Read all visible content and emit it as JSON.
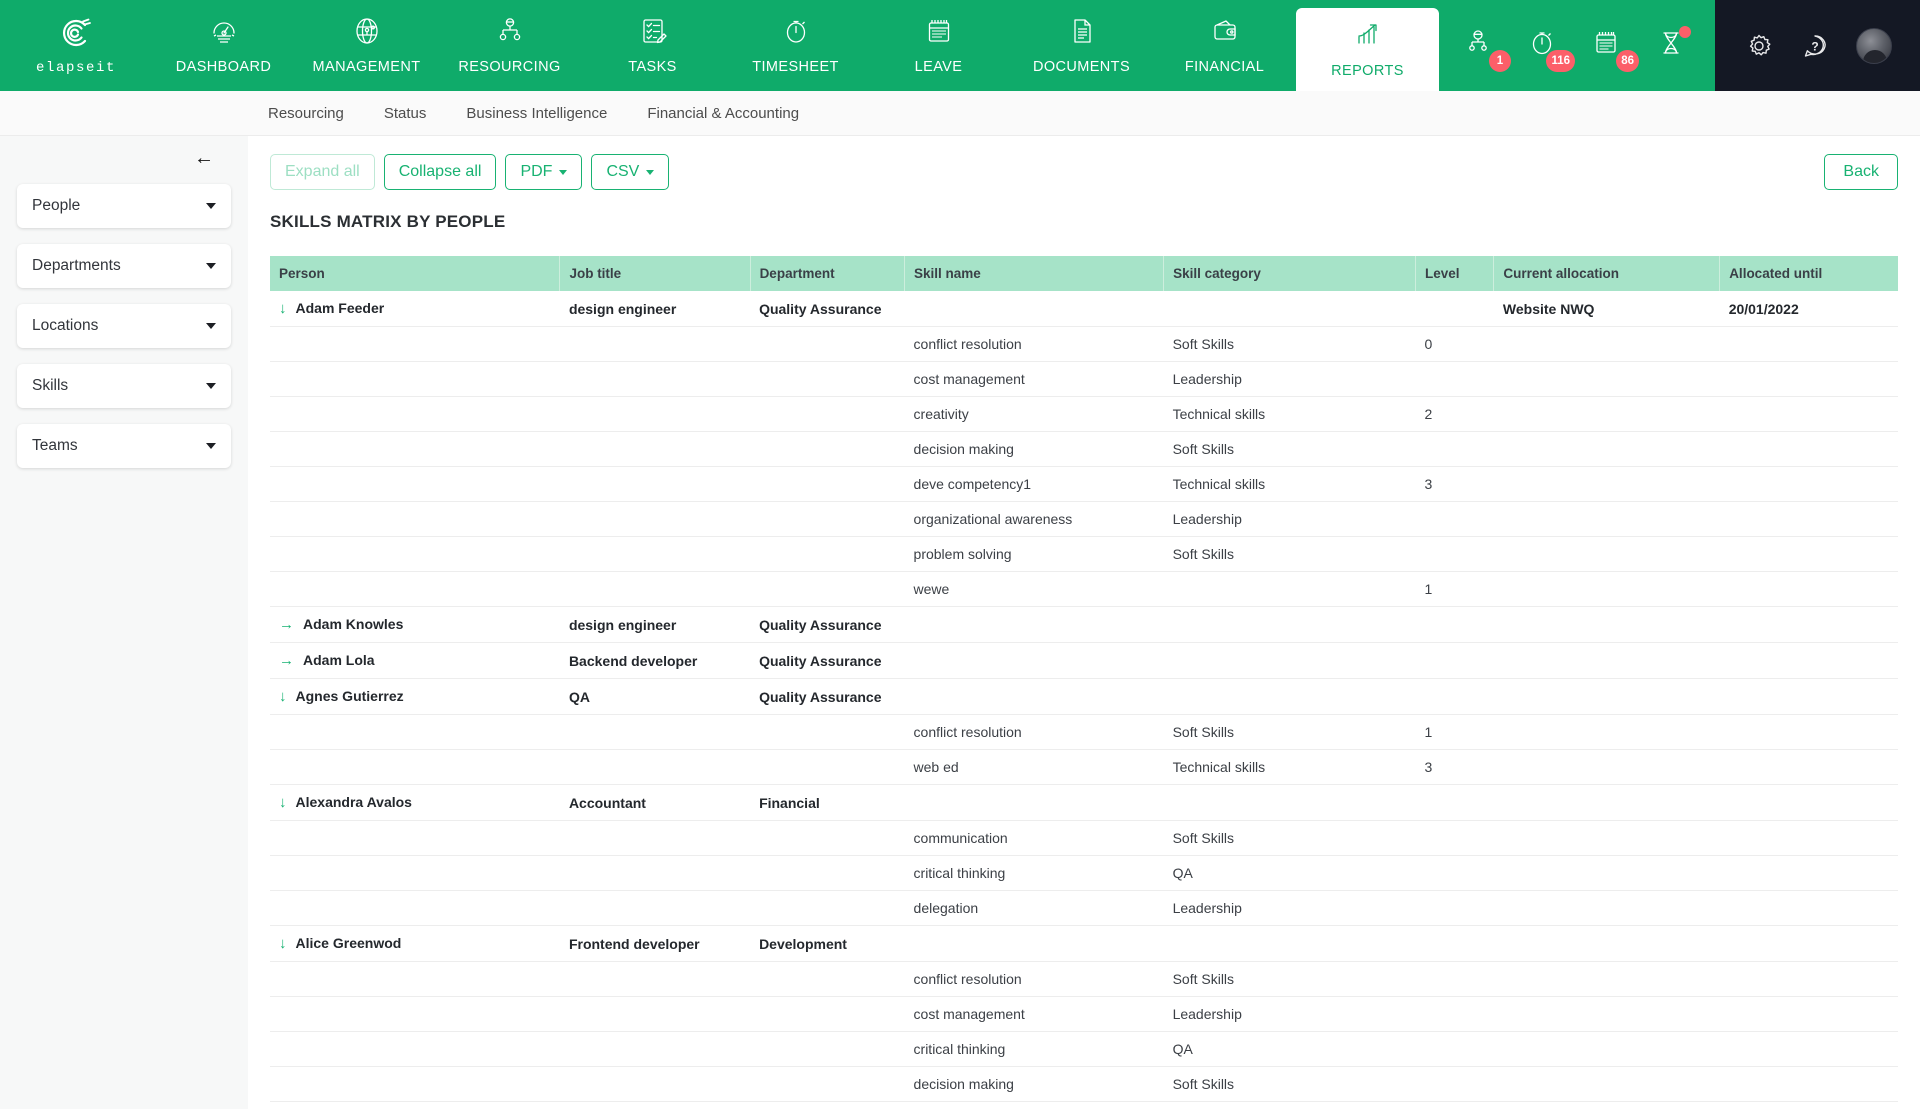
{
  "brand": {
    "name": "elapseit",
    "icon": "elapseit-logo-icon"
  },
  "topnav": {
    "items": [
      {
        "label": "DASHBOARD",
        "icon": "dashboard-icon",
        "active": false
      },
      {
        "label": "MANAGEMENT",
        "icon": "globe-icon",
        "active": false
      },
      {
        "label": "RESOURCING",
        "icon": "resourcing-icon",
        "active": false
      },
      {
        "label": "TASKS",
        "icon": "tasks-icon",
        "active": false
      },
      {
        "label": "TIMESHEET",
        "icon": "stopwatch-icon",
        "active": false
      },
      {
        "label": "LEAVE",
        "icon": "calendar-icon",
        "active": false
      },
      {
        "label": "DOCUMENTS",
        "icon": "document-icon",
        "active": false
      },
      {
        "label": "FINANCIAL",
        "icon": "wallet-icon",
        "active": false
      },
      {
        "label": "REPORTS",
        "icon": "chart-up-icon",
        "active": true
      }
    ],
    "badges": [
      {
        "icon": "person-approval-icon",
        "count": "1"
      },
      {
        "icon": "stopwatch-pending-icon",
        "count": "116"
      },
      {
        "icon": "calendar-pending-icon",
        "count": "86"
      },
      {
        "icon": "hourglass-icon",
        "count": ""
      }
    ],
    "right_icons": [
      {
        "icon": "gear-icon"
      },
      {
        "icon": "question-help-icon"
      },
      {
        "icon": "user-avatar"
      }
    ]
  },
  "subnav": {
    "tabs": [
      {
        "label": "Resourcing"
      },
      {
        "label": "Status"
      },
      {
        "label": "Business Intelligence"
      },
      {
        "label": "Financial & Accounting"
      }
    ]
  },
  "sidebar": {
    "collapse_icon": "arrow-left-icon",
    "filters": [
      {
        "label": "People"
      },
      {
        "label": "Departments"
      },
      {
        "label": "Locations"
      },
      {
        "label": "Skills"
      },
      {
        "label": "Teams"
      }
    ]
  },
  "toolbar": {
    "expand_all": "Expand all",
    "collapse_all": "Collapse all",
    "pdf": "PDF",
    "csv": "CSV",
    "back": "Back"
  },
  "report": {
    "title": "SKILLS MATRIX BY PEOPLE",
    "columns": [
      "Person",
      "Job title",
      "Department",
      "Skill name",
      "Skill category",
      "Level",
      "Current allocation",
      "Allocated until"
    ],
    "rows": [
      {
        "type": "person",
        "expanded": true,
        "arrow": "↓",
        "person": "Adam Feeder",
        "job": "design engineer",
        "dept": "Quality Assurance",
        "skill": "",
        "category": "",
        "level": "",
        "allocation": "Website NWQ",
        "until": "20/01/2022"
      },
      {
        "type": "skill",
        "skill": "conflict resolution",
        "category": "Soft Skills",
        "level": "0"
      },
      {
        "type": "skill",
        "skill": "cost management",
        "category": "Leadership",
        "level": ""
      },
      {
        "type": "skill",
        "skill": "creativity",
        "category": "Technical skills",
        "level": "2"
      },
      {
        "type": "skill",
        "skill": "decision making",
        "category": "Soft Skills",
        "level": ""
      },
      {
        "type": "skill",
        "skill": "deve competency1",
        "category": "Technical skills",
        "level": "3"
      },
      {
        "type": "skill",
        "skill": "organizational awareness",
        "category": "Leadership",
        "level": ""
      },
      {
        "type": "skill",
        "skill": "problem solving",
        "category": "Soft Skills",
        "level": ""
      },
      {
        "type": "skill",
        "skill": "wewe",
        "category": "",
        "level": "1"
      },
      {
        "type": "person",
        "expanded": false,
        "arrow": "→",
        "person": "Adam Knowles",
        "job": "design engineer",
        "dept": "Quality Assurance",
        "skill": "",
        "category": "",
        "level": "",
        "allocation": "",
        "until": ""
      },
      {
        "type": "person",
        "expanded": false,
        "arrow": "→",
        "person": "Adam Lola",
        "job": "Backend developer",
        "dept": "Quality Assurance",
        "skill": "",
        "category": "",
        "level": "",
        "allocation": "",
        "until": ""
      },
      {
        "type": "person",
        "expanded": true,
        "arrow": "↓",
        "person": "Agnes Gutierrez",
        "job": "QA",
        "dept": "Quality Assurance",
        "skill": "",
        "category": "",
        "level": "",
        "allocation": "",
        "until": ""
      },
      {
        "type": "skill",
        "skill": "conflict resolution",
        "category": "Soft Skills",
        "level": "1"
      },
      {
        "type": "skill",
        "skill": "web ed",
        "category": "Technical skills",
        "level": "3"
      },
      {
        "type": "person",
        "expanded": true,
        "arrow": "↓",
        "person": "Alexandra Avalos",
        "job": "Accountant",
        "dept": "Financial",
        "skill": "",
        "category": "",
        "level": "",
        "allocation": "",
        "until": ""
      },
      {
        "type": "skill",
        "skill": "communication",
        "category": "Soft Skills",
        "level": ""
      },
      {
        "type": "skill",
        "skill": "critical thinking",
        "category": "QA",
        "level": ""
      },
      {
        "type": "skill",
        "skill": "delegation",
        "category": "Leadership",
        "level": ""
      },
      {
        "type": "person",
        "expanded": true,
        "arrow": "↓",
        "person": "Alice Greenwod",
        "job": "Frontend developer",
        "dept": "Development",
        "skill": "",
        "category": "",
        "level": "",
        "allocation": "",
        "until": ""
      },
      {
        "type": "skill",
        "skill": "conflict resolution",
        "category": "Soft Skills",
        "level": ""
      },
      {
        "type": "skill",
        "skill": "cost management",
        "category": "Leadership",
        "level": ""
      },
      {
        "type": "skill",
        "skill": "critical thinking",
        "category": "QA",
        "level": ""
      },
      {
        "type": "skill",
        "skill": "decision making",
        "category": "Soft Skills",
        "level": ""
      }
    ]
  },
  "colors": {
    "brand_green": "#0fab6a",
    "accent_green": "#18b272",
    "table_header": "#a6e3c8",
    "badge_red": "#fc5f69",
    "dark_panel": "#141824"
  }
}
